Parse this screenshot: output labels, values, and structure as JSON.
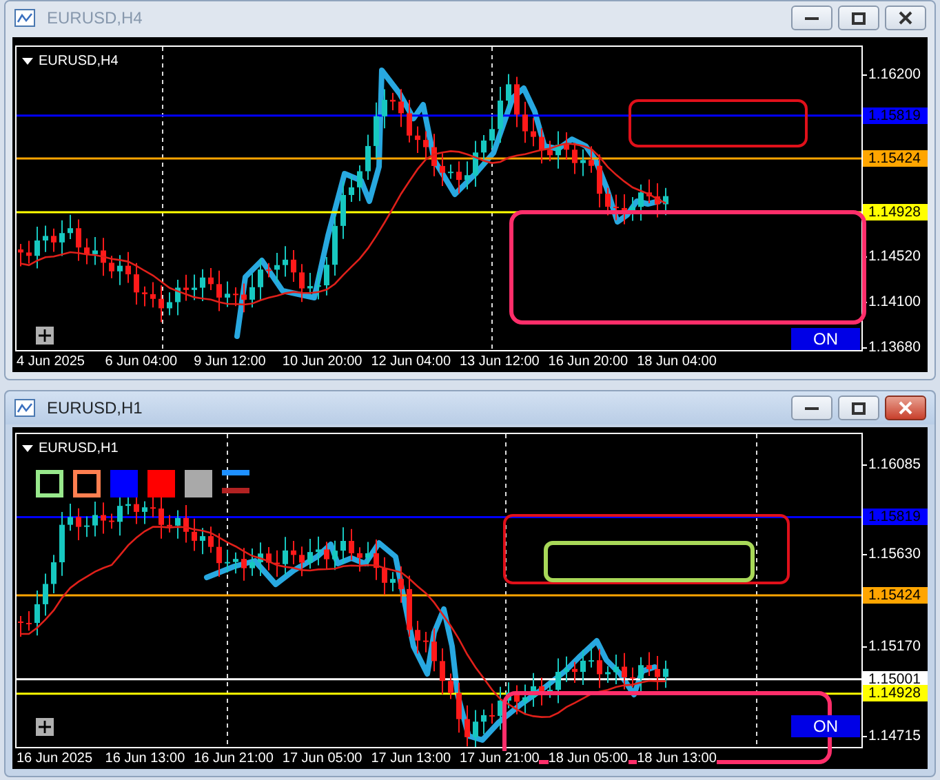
{
  "windows": [
    {
      "title": "EURUSD,H4",
      "active": false,
      "chart": {
        "symbol": "EURUSD,H4",
        "price_ticks": [
          "1.16200",
          "1.14520",
          "1.14100",
          "1.13680"
        ],
        "levels": [
          {
            "label": "1.15819",
            "color": "#0000ff"
          },
          {
            "label": "1.15424",
            "color": "#ffa500"
          },
          {
            "label": "1.14928",
            "color": "#ffff00"
          }
        ],
        "time_labels": [
          "4 Jun 2025",
          "6 Jun 04:00",
          "9 Jun 12:00",
          "10 Jun 20:00",
          "12 Jun 04:00",
          "13 Jun 12:00",
          "16 Jun 20:00",
          "18 Jun 04:00"
        ],
        "toggle": "ON"
      }
    },
    {
      "title": "EURUSD,H1",
      "active": true,
      "chart": {
        "symbol": "EURUSD,H1",
        "palette": [
          {
            "kind": "outline",
            "color": "#98e88c"
          },
          {
            "kind": "outline",
            "color": "#ff7f50"
          },
          {
            "kind": "fill",
            "color": "#0000ff"
          },
          {
            "kind": "fill",
            "color": "#ff0000"
          },
          {
            "kind": "fill",
            "color": "#a9a9a9"
          },
          {
            "kind": "dashes",
            "color": "#1e90ff"
          }
        ],
        "price_ticks": [
          "1.16085",
          "1.15630",
          "1.15170",
          "1.14715"
        ],
        "levels": [
          {
            "label": "1.15819",
            "color": "#0000ff"
          },
          {
            "label": "1.15424",
            "color": "#ffa500"
          },
          {
            "label": "1.15001",
            "color": "#ffffff"
          },
          {
            "label": "1.14928",
            "color": "#ffff00"
          }
        ],
        "time_labels": [
          "16 Jun 2025",
          "16 Jun 13:00",
          "16 Jun 21:00",
          "17 Jun 05:00",
          "17 Jun 13:00",
          "17 Jun 21:00",
          "18 Jun 05:00",
          "18 Jun 13:00"
        ],
        "toggle": "ON"
      }
    }
  ]
}
